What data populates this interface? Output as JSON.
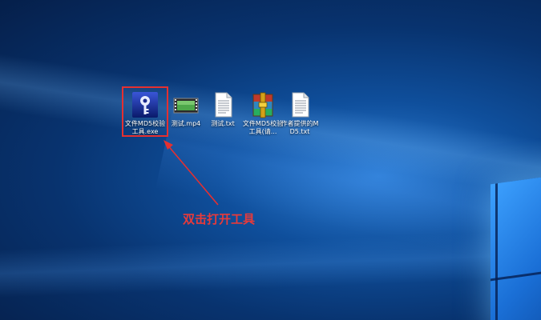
{
  "desktop_icons": [
    {
      "label": "文件MD5校验工具.exe",
      "icon": "key-tool-icon"
    },
    {
      "label": "测试.mp4",
      "icon": "video-file-icon"
    },
    {
      "label": "测试.txt",
      "icon": "text-file-icon"
    },
    {
      "label": "文件MD5校验工具(请...",
      "icon": "winrar-archive-icon"
    },
    {
      "label": "作者提供的MD5.txt",
      "icon": "text-file-icon"
    }
  ],
  "annotation": {
    "text": "双击打开工具",
    "color": "#e83a3a"
  },
  "colors": {
    "highlight": "#e53030",
    "label_text": "#ffffff"
  }
}
